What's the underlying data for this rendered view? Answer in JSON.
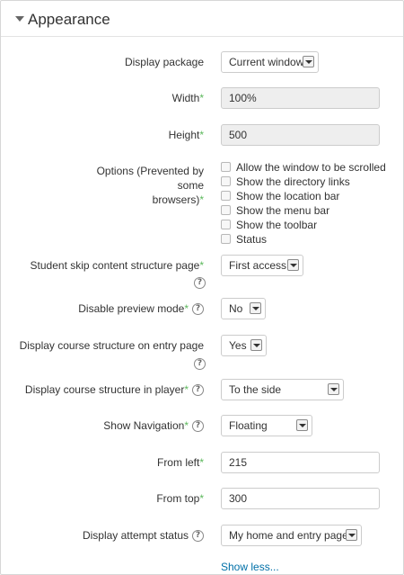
{
  "section": {
    "title": "Appearance"
  },
  "fields": {
    "display_package": {
      "label": "Display package",
      "value": "Current window"
    },
    "width": {
      "label": "Width",
      "value": "100%"
    },
    "height": {
      "label": "Height",
      "value": "500"
    },
    "options": {
      "label_line1": "Options (Prevented by some",
      "label_line2": "browsers)",
      "items": [
        "Allow the window to be scrolled",
        "Show the directory links",
        "Show the location bar",
        "Show the menu bar",
        "Show the toolbar",
        "Status"
      ]
    },
    "skip_content": {
      "label": "Student skip content structure page",
      "value": "First access"
    },
    "disable_preview": {
      "label": "Disable preview mode",
      "value": "No"
    },
    "course_structure_entry": {
      "label": "Display course structure on entry page",
      "value": "Yes"
    },
    "course_structure_player": {
      "label": "Display course structure in player",
      "value": "To the side"
    },
    "show_navigation": {
      "label": "Show Navigation",
      "value": "Floating"
    },
    "from_left": {
      "label": "From left",
      "value": "215"
    },
    "from_top": {
      "label": "From top",
      "value": "300"
    },
    "attempt_status": {
      "label": "Display attempt status",
      "value": "My home and entry page"
    }
  },
  "required_marker": "*",
  "help_glyph": "?",
  "show_less": "Show less...",
  "colors": {
    "required": "#5cb85c",
    "link": "#0070a8"
  }
}
